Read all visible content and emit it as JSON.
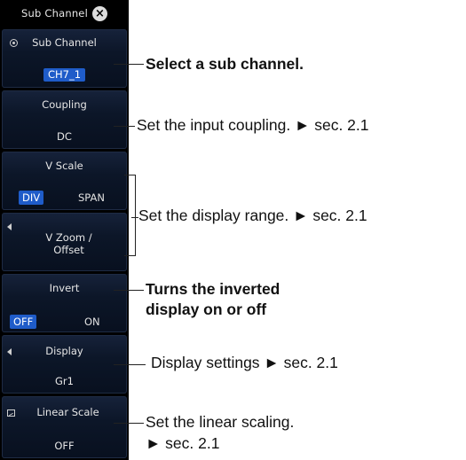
{
  "menu": {
    "title": "Sub Channel",
    "close_icon": "close-circle-icon",
    "items": {
      "sub_channel": {
        "label": "Sub Channel",
        "value": "CH7_1",
        "icon": "radio-icon"
      },
      "coupling": {
        "label": "Coupling",
        "value": "DC"
      },
      "v_scale": {
        "label": "V Scale",
        "options": [
          "DIV",
          "SPAN"
        ],
        "selected": "DIV"
      },
      "v_zoom": {
        "label": "V Zoom /\nOffset",
        "icon": "left-arrow-icon"
      },
      "invert": {
        "label": "Invert",
        "options": [
          "OFF",
          "ON"
        ],
        "selected": "OFF"
      },
      "display": {
        "label": "Display",
        "value": "Gr1",
        "icon": "left-arrow-icon"
      },
      "linear_scale": {
        "label": "Linear Scale",
        "value": "OFF",
        "icon": "scale-icon"
      }
    }
  },
  "annotations": {
    "sub_channel": "Select a sub channel.",
    "coupling": "Set the input coupling. ► sec. 2.1",
    "display_range": "Set the display range. ► sec. 2.1",
    "invert_line1": "Turns the inverted",
    "invert_line2": "display on or off",
    "display": "Display settings ► sec. 2.1",
    "linear_line1": "Set the linear scaling.",
    "linear_line2": "► sec. 2.1"
  },
  "colors": {
    "panel_background": "#000000",
    "item_background": "#0c1628",
    "selected_highlight": "#1f5cc9",
    "text": "#e6e6e6"
  }
}
